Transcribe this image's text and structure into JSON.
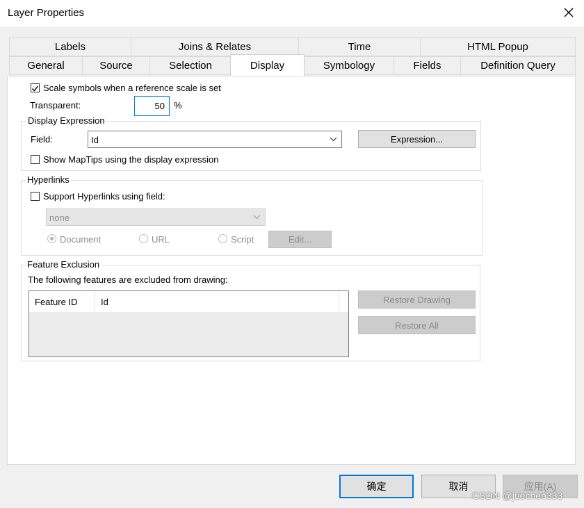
{
  "window": {
    "title": "Layer Properties"
  },
  "tabs_row1": [
    "Labels",
    "Joins & Relates",
    "Time",
    "HTML Popup"
  ],
  "tabs_row2": [
    "General",
    "Source",
    "Selection",
    "Display",
    "Symbology",
    "Fields",
    "Definition Query"
  ],
  "display": {
    "scale_symbols_label": "Scale symbols when a reference scale is set",
    "scale_symbols_checked": true,
    "transparent_label": "Transparent:",
    "transparent_value": "50",
    "transparent_unit": "%",
    "display_expression": {
      "group_title": "Display Expression",
      "field_label": "Field:",
      "field_value": "Id",
      "expression_button": "Expression...",
      "maptips_label": "Show MapTips using the display expression",
      "maptips_checked": false
    },
    "hyperlinks": {
      "group_title": "Hyperlinks",
      "support_label": "Support Hyperlinks using field:",
      "support_checked": false,
      "field_value": "none",
      "radio_document": "Document",
      "radio_url": "URL",
      "radio_script": "Script",
      "edit_button": "Edit..."
    },
    "feature_exclusion": {
      "group_title": "Feature Exclusion",
      "description": "The following features are excluded from drawing:",
      "columns": [
        "Feature ID",
        "Id"
      ],
      "restore_drawing_button": "Restore Drawing",
      "restore_all_button": "Restore All"
    }
  },
  "footer": {
    "ok_button": "确定",
    "cancel_button": "取消",
    "apply_button": "应用(A)",
    "watermark": "CSDN @juechen333"
  }
}
